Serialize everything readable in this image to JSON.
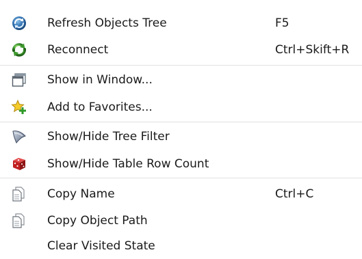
{
  "menu": {
    "items": [
      {
        "label": "Refresh Objects Tree",
        "shortcut": "F5",
        "icon": "refresh-icon"
      },
      {
        "label": "Reconnect",
        "shortcut": "Ctrl+Skift+R",
        "icon": "reconnect-icon"
      },
      {
        "label": "Show in Window...",
        "shortcut": "",
        "icon": "window-icon"
      },
      {
        "label": "Add to Favorites...",
        "shortcut": "",
        "icon": "favorites-star-icon"
      },
      {
        "label": "Show/Hide Tree Filter",
        "shortcut": "",
        "icon": "filter-funnel-icon"
      },
      {
        "label": "Show/Hide Table Row Count",
        "shortcut": "",
        "icon": "dice-icon"
      },
      {
        "label": "Copy Name",
        "shortcut": "Ctrl+C",
        "icon": "copy-document-icon"
      },
      {
        "label": "Copy Object Path",
        "shortcut": "",
        "icon": "copy-document-icon"
      },
      {
        "label": "Clear Visited State",
        "shortcut": "",
        "icon": ""
      }
    ]
  },
  "colors": {
    "background": "#ffffff",
    "separator": "#e1e1e1",
    "text": "#1a1a1a"
  }
}
